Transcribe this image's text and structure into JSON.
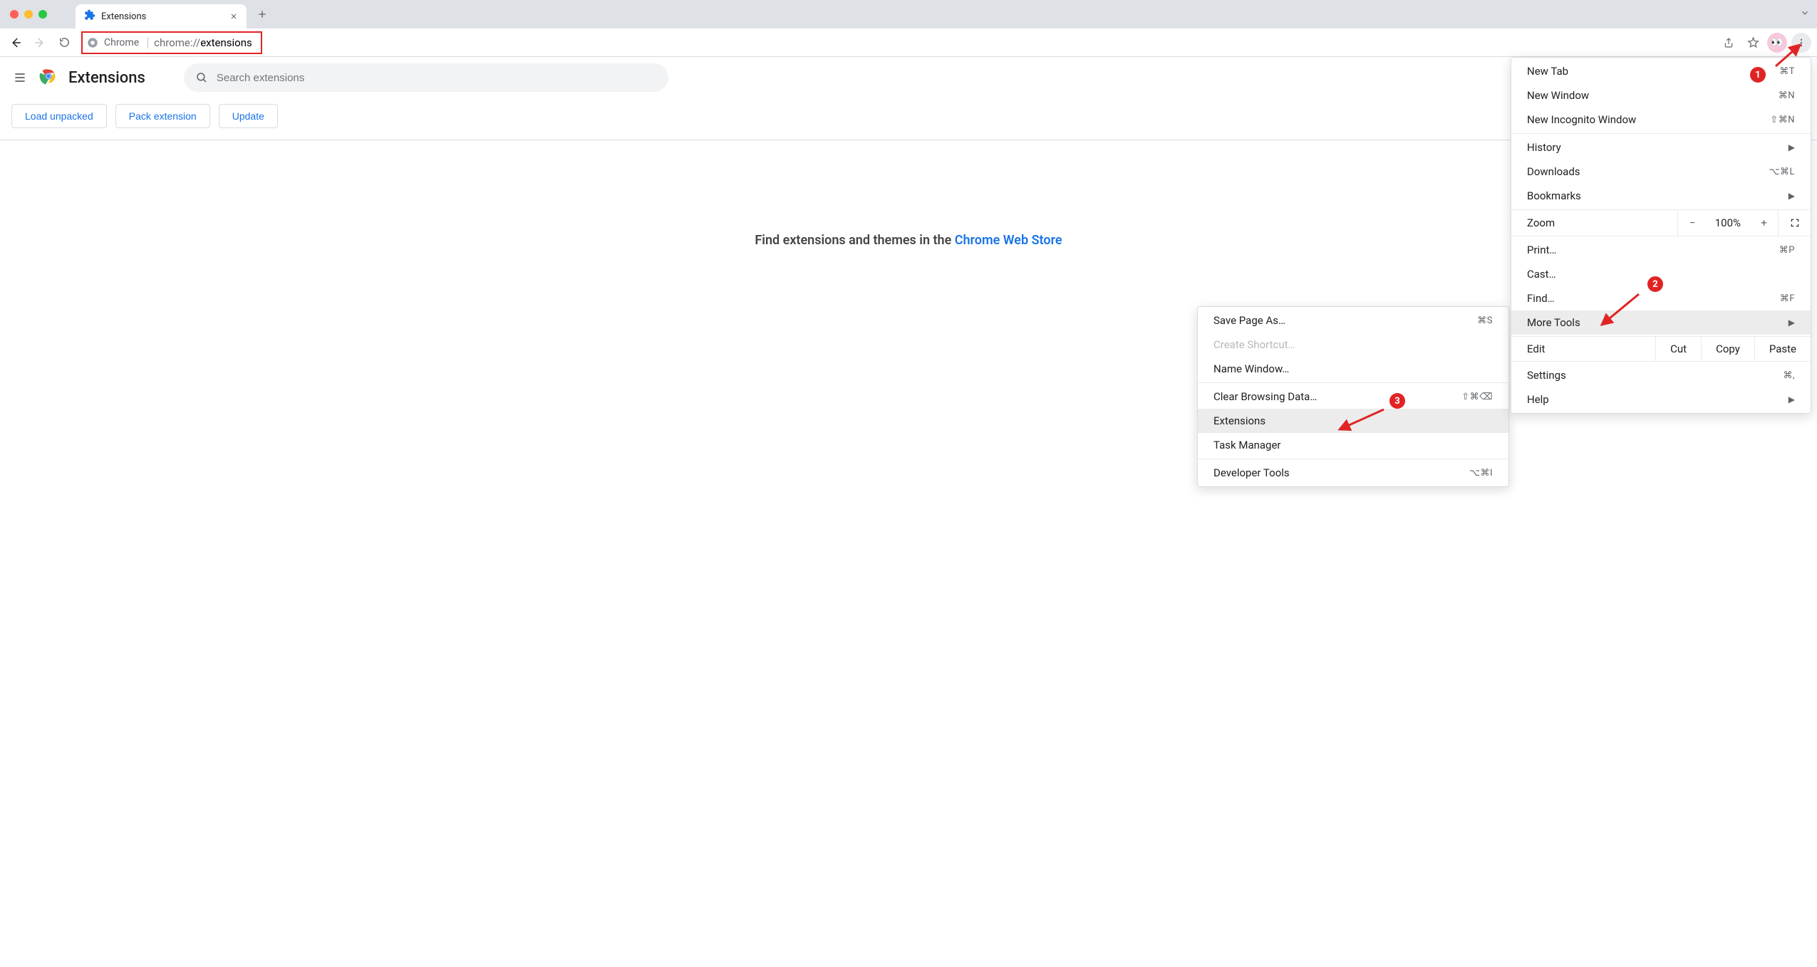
{
  "tab": {
    "title": "Extensions"
  },
  "toolbar": {
    "chip_label": "Chrome",
    "url_prefix": "chrome://",
    "url_path": "extensions"
  },
  "ext_page": {
    "title": "Extensions",
    "search_placeholder": "Search extensions",
    "buttons": {
      "load_unpacked": "Load unpacked",
      "pack_extension": "Pack extension",
      "update": "Update"
    },
    "find_prefix": "Find extensions and themes in the ",
    "store_link": "Chrome Web Store"
  },
  "menu": {
    "new_tab": "New Tab",
    "new_tab_accel": "⌘T",
    "new_window": "New Window",
    "new_window_accel": "⌘N",
    "new_incognito": "New Incognito Window",
    "new_incognito_accel": "⇧⌘N",
    "history": "History",
    "downloads": "Downloads",
    "downloads_accel": "⌥⌘L",
    "bookmarks": "Bookmarks",
    "zoom": "Zoom",
    "zoom_pct": "100%",
    "print": "Print…",
    "print_accel": "⌘P",
    "cast": "Cast…",
    "find": "Find…",
    "find_accel": "⌘F",
    "more_tools": "More Tools",
    "edit": "Edit",
    "cut": "Cut",
    "copy": "Copy",
    "paste": "Paste",
    "settings": "Settings",
    "settings_accel": "⌘,",
    "help": "Help"
  },
  "submenu": {
    "save_page": "Save Page As…",
    "save_page_accel": "⌘S",
    "create_shortcut": "Create Shortcut…",
    "name_window": "Name Window…",
    "clear_data": "Clear Browsing Data…",
    "clear_data_accel": "⇧⌘⌫",
    "extensions": "Extensions",
    "task_manager": "Task Manager",
    "dev_tools": "Developer Tools",
    "dev_tools_accel": "⌥⌘I"
  },
  "annot": {
    "b1": "1",
    "b2": "2",
    "b3": "3"
  }
}
